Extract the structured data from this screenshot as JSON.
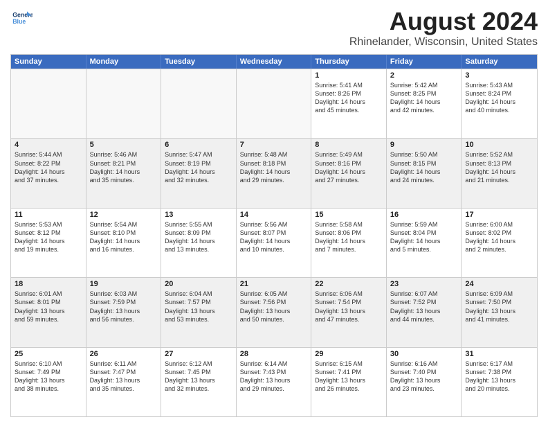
{
  "header": {
    "logo_line1": "General",
    "logo_line2": "Blue",
    "main_title": "August 2024",
    "subtitle": "Rhinelander, Wisconsin, United States"
  },
  "calendar": {
    "days_of_week": [
      "Sunday",
      "Monday",
      "Tuesday",
      "Wednesday",
      "Thursday",
      "Friday",
      "Saturday"
    ],
    "rows": [
      [
        {
          "day": "",
          "empty": true
        },
        {
          "day": "",
          "empty": true
        },
        {
          "day": "",
          "empty": true
        },
        {
          "day": "",
          "empty": true
        },
        {
          "day": "1",
          "text": "Sunrise: 5:41 AM\nSunset: 8:26 PM\nDaylight: 14 hours\nand 45 minutes."
        },
        {
          "day": "2",
          "text": "Sunrise: 5:42 AM\nSunset: 8:25 PM\nDaylight: 14 hours\nand 42 minutes."
        },
        {
          "day": "3",
          "text": "Sunrise: 5:43 AM\nSunset: 8:24 PM\nDaylight: 14 hours\nand 40 minutes."
        }
      ],
      [
        {
          "day": "4",
          "text": "Sunrise: 5:44 AM\nSunset: 8:22 PM\nDaylight: 14 hours\nand 37 minutes.",
          "shaded": true
        },
        {
          "day": "5",
          "text": "Sunrise: 5:46 AM\nSunset: 8:21 PM\nDaylight: 14 hours\nand 35 minutes.",
          "shaded": true
        },
        {
          "day": "6",
          "text": "Sunrise: 5:47 AM\nSunset: 8:19 PM\nDaylight: 14 hours\nand 32 minutes.",
          "shaded": true
        },
        {
          "day": "7",
          "text": "Sunrise: 5:48 AM\nSunset: 8:18 PM\nDaylight: 14 hours\nand 29 minutes.",
          "shaded": true
        },
        {
          "day": "8",
          "text": "Sunrise: 5:49 AM\nSunset: 8:16 PM\nDaylight: 14 hours\nand 27 minutes.",
          "shaded": true
        },
        {
          "day": "9",
          "text": "Sunrise: 5:50 AM\nSunset: 8:15 PM\nDaylight: 14 hours\nand 24 minutes.",
          "shaded": true
        },
        {
          "day": "10",
          "text": "Sunrise: 5:52 AM\nSunset: 8:13 PM\nDaylight: 14 hours\nand 21 minutes.",
          "shaded": true
        }
      ],
      [
        {
          "day": "11",
          "text": "Sunrise: 5:53 AM\nSunset: 8:12 PM\nDaylight: 14 hours\nand 19 minutes."
        },
        {
          "day": "12",
          "text": "Sunrise: 5:54 AM\nSunset: 8:10 PM\nDaylight: 14 hours\nand 16 minutes."
        },
        {
          "day": "13",
          "text": "Sunrise: 5:55 AM\nSunset: 8:09 PM\nDaylight: 14 hours\nand 13 minutes."
        },
        {
          "day": "14",
          "text": "Sunrise: 5:56 AM\nSunset: 8:07 PM\nDaylight: 14 hours\nand 10 minutes."
        },
        {
          "day": "15",
          "text": "Sunrise: 5:58 AM\nSunset: 8:06 PM\nDaylight: 14 hours\nand 7 minutes."
        },
        {
          "day": "16",
          "text": "Sunrise: 5:59 AM\nSunset: 8:04 PM\nDaylight: 14 hours\nand 5 minutes."
        },
        {
          "day": "17",
          "text": "Sunrise: 6:00 AM\nSunset: 8:02 PM\nDaylight: 14 hours\nand 2 minutes."
        }
      ],
      [
        {
          "day": "18",
          "text": "Sunrise: 6:01 AM\nSunset: 8:01 PM\nDaylight: 13 hours\nand 59 minutes.",
          "shaded": true
        },
        {
          "day": "19",
          "text": "Sunrise: 6:03 AM\nSunset: 7:59 PM\nDaylight: 13 hours\nand 56 minutes.",
          "shaded": true
        },
        {
          "day": "20",
          "text": "Sunrise: 6:04 AM\nSunset: 7:57 PM\nDaylight: 13 hours\nand 53 minutes.",
          "shaded": true
        },
        {
          "day": "21",
          "text": "Sunrise: 6:05 AM\nSunset: 7:56 PM\nDaylight: 13 hours\nand 50 minutes.",
          "shaded": true
        },
        {
          "day": "22",
          "text": "Sunrise: 6:06 AM\nSunset: 7:54 PM\nDaylight: 13 hours\nand 47 minutes.",
          "shaded": true
        },
        {
          "day": "23",
          "text": "Sunrise: 6:07 AM\nSunset: 7:52 PM\nDaylight: 13 hours\nand 44 minutes.",
          "shaded": true
        },
        {
          "day": "24",
          "text": "Sunrise: 6:09 AM\nSunset: 7:50 PM\nDaylight: 13 hours\nand 41 minutes.",
          "shaded": true
        }
      ],
      [
        {
          "day": "25",
          "text": "Sunrise: 6:10 AM\nSunset: 7:49 PM\nDaylight: 13 hours\nand 38 minutes."
        },
        {
          "day": "26",
          "text": "Sunrise: 6:11 AM\nSunset: 7:47 PM\nDaylight: 13 hours\nand 35 minutes."
        },
        {
          "day": "27",
          "text": "Sunrise: 6:12 AM\nSunset: 7:45 PM\nDaylight: 13 hours\nand 32 minutes."
        },
        {
          "day": "28",
          "text": "Sunrise: 6:14 AM\nSunset: 7:43 PM\nDaylight: 13 hours\nand 29 minutes."
        },
        {
          "day": "29",
          "text": "Sunrise: 6:15 AM\nSunset: 7:41 PM\nDaylight: 13 hours\nand 26 minutes."
        },
        {
          "day": "30",
          "text": "Sunrise: 6:16 AM\nSunset: 7:40 PM\nDaylight: 13 hours\nand 23 minutes."
        },
        {
          "day": "31",
          "text": "Sunrise: 6:17 AM\nSunset: 7:38 PM\nDaylight: 13 hours\nand 20 minutes."
        }
      ]
    ]
  }
}
